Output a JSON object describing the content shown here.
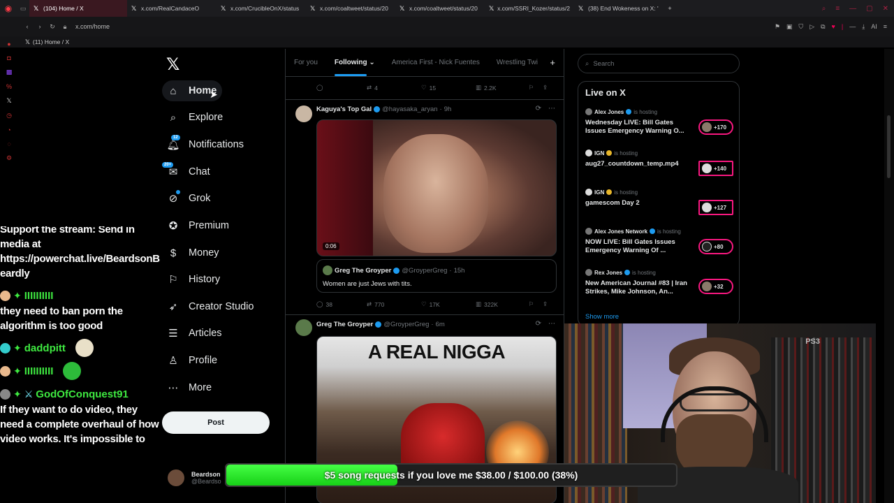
{
  "browser": {
    "tabs": [
      {
        "label": "(104) Home / X",
        "active": true
      },
      {
        "label": "x.com/RealCandaceO",
        "active": false
      },
      {
        "label": "x.com/CrucibleOnX/status",
        "active": false
      },
      {
        "label": "x.com/coaltweet/status/20",
        "active": false
      },
      {
        "label": "x.com/coaltweet/status/20",
        "active": false
      },
      {
        "label": "x.com/SSRI_Kozer/status/2",
        "active": false
      },
      {
        "label": "(38) End Wokeness on X: '",
        "active": false
      }
    ],
    "url": "x.com/home",
    "bookmark": "(11) Home / X",
    "ai_label": "AI"
  },
  "sidebar": {
    "items": [
      {
        "label": "Home",
        "icon": "home-icon",
        "active": true
      },
      {
        "label": "Explore",
        "icon": "search-icon"
      },
      {
        "label": "Notifications",
        "icon": "bell-icon",
        "badge": "12"
      },
      {
        "label": "Chat",
        "icon": "chat-icon",
        "badge": "20+"
      },
      {
        "label": "Grok",
        "icon": "grok-icon"
      },
      {
        "label": "Premium",
        "icon": "premium-icon"
      },
      {
        "label": "Money",
        "icon": "money-icon"
      },
      {
        "label": "History",
        "icon": "bookmark-icon"
      },
      {
        "label": "Creator Studio",
        "icon": "rocket-icon"
      },
      {
        "label": "Articles",
        "icon": "articles-icon"
      },
      {
        "label": "Profile",
        "icon": "profile-icon"
      },
      {
        "label": "More",
        "icon": "more-icon"
      }
    ],
    "post_label": "Post",
    "account_name": "Beardson",
    "account_handle": "@Beardso"
  },
  "chat": {
    "msg1": [
      "Support the stream: Send in",
      "media at",
      "https://powerchat.live/BeardsonB",
      "eardly"
    ],
    "user2": "IIIIIIIIII",
    "msg2": [
      "they need to ban porn the",
      "algorithm is too good"
    ],
    "user3": "daddpitt",
    "user4": "IIIIIIIIII",
    "user5": "GodOfConquest91",
    "msg5": [
      "If they want to do video, they",
      "need a complete overhaul of how",
      "video works. It's impossible to"
    ]
  },
  "timeline": {
    "tabs": [
      "For you",
      "Following",
      "America First - Nick Fuentes",
      "Wrestling Twi"
    ],
    "active_tab": "Following",
    "prev_actions": {
      "retweets": "4",
      "likes": "15",
      "views": "2.2K"
    },
    "tweet1": {
      "name": "Kaguya's Top Gal",
      "handle": "@hayasaka_aryan",
      "time": "9h",
      "video_time": "0:06",
      "quote_name": "Greg The Groyper",
      "quote_handle": "@GroyperGreg",
      "quote_time": "15h",
      "quote_text": "Women are just Jews with tits.",
      "replies": "38",
      "retweets": "770",
      "likes": "17K",
      "views": "322K"
    },
    "tweet2": {
      "name": "Greg The Groyper",
      "handle": "@GroyperGreg",
      "time": "6m",
      "caption": "A REAL NIGGA"
    }
  },
  "right": {
    "search_placeholder": "Search",
    "live_title": "Live on X",
    "hosting_label": "is hosting",
    "live_items": [
      {
        "host": "Alex Jones",
        "title": "Wednesday LIVE: Bill Gates Issues Emergency Warning O...",
        "count": "+170",
        "verified": "blue"
      },
      {
        "host": "IGN",
        "title": "aug27_countdown_temp.mp4",
        "count": "+140",
        "verified": "gold"
      },
      {
        "host": "IGN",
        "title": "gamescom Day 2",
        "count": "+127",
        "verified": "gold"
      },
      {
        "host": "Alex Jones Network",
        "title": "NOW LIVE: Bill Gates Issues Emergency Warning Of ...",
        "count": "+80",
        "verified": "blue"
      },
      {
        "host": "Rex Jones",
        "title": "New American Journal #83 | Iran Strikes, Mike Johnson, An...",
        "count": "+32",
        "verified": "blue"
      }
    ],
    "show_more": "Show more"
  },
  "webcam": {
    "console_label": "PS3"
  },
  "goal": {
    "text": "$5 song requests if you love me $38.00 / $100.00 (38%)",
    "progress": 0.38,
    "color": "#22e022"
  }
}
